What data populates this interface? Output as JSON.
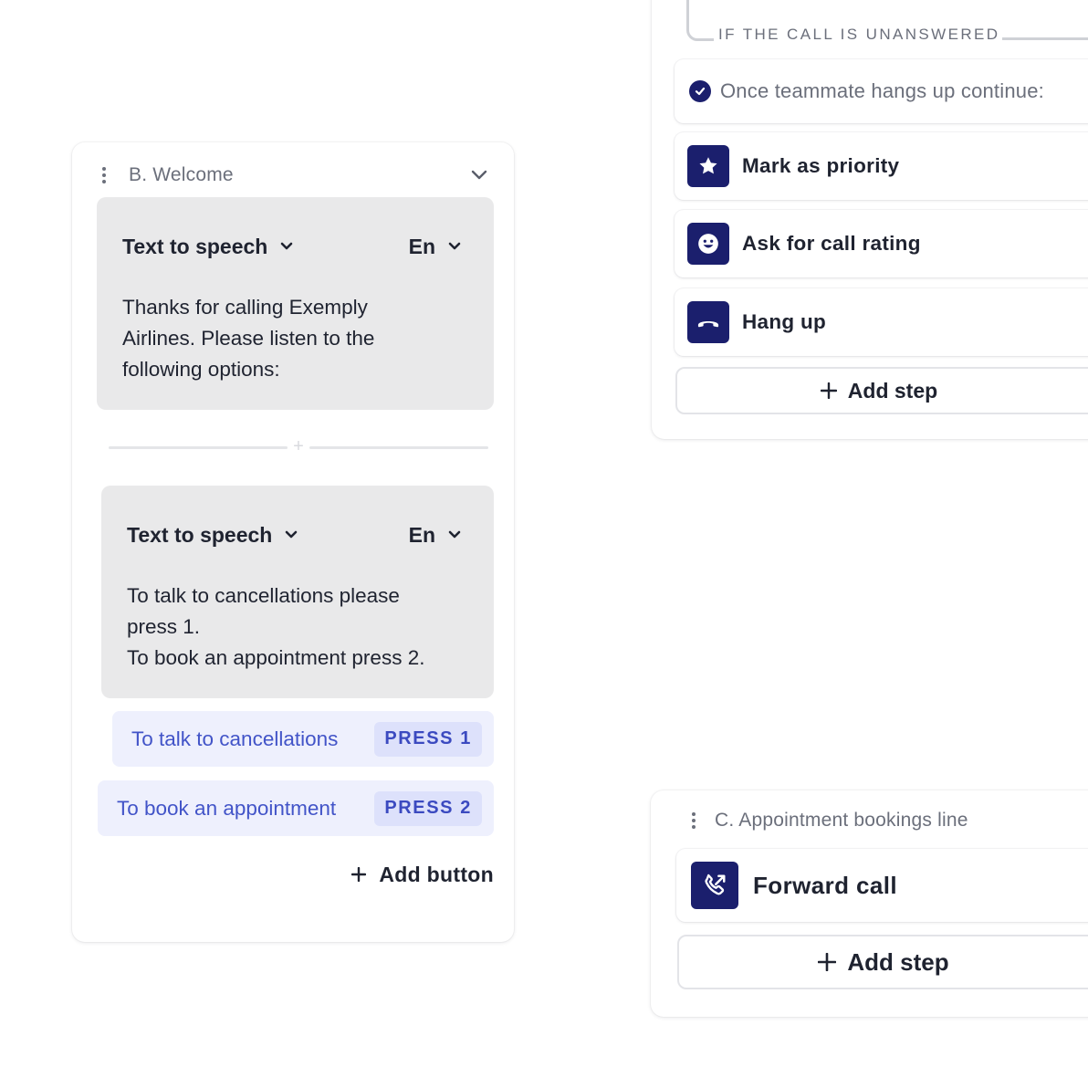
{
  "colors": {
    "icon_bg": "#1b1f6d",
    "option_bg": "#eef0fd",
    "option_text": "#4254c8",
    "badge_bg": "#dde1fb",
    "tts_block_bg": "#e9e9ea",
    "muted_text": "#6b6f7b"
  },
  "card_b": {
    "title": "B. Welcome",
    "tts_blocks": [
      {
        "type_label": "Text to speech",
        "language": "En",
        "text": "Thanks for calling Exemply\nAirlines. Please listen to the\nfollowing options:"
      },
      {
        "type_label": "Text to speech",
        "language": "En",
        "text": "To talk to cancellations please\npress 1.\nTo book an appointment press 2."
      }
    ],
    "options": [
      {
        "label": "To talk to cancellations",
        "badge": "PRESS 1"
      },
      {
        "label": "To book an appointment",
        "badge": "PRESS 2"
      }
    ],
    "add_button_label": "Add button"
  },
  "card_top": {
    "branch_label": "IF THE CALL IS UNANSWERED",
    "continue_label": "Once teammate hangs up continue:",
    "steps": [
      {
        "label": "Mark as priority",
        "icon": "star-icon"
      },
      {
        "label": "Ask for call rating",
        "icon": "smiley-icon"
      },
      {
        "label": "Hang up",
        "icon": "hang-up-icon"
      }
    ],
    "add_step_label": "Add step"
  },
  "card_c": {
    "title": "C. Appointment bookings line",
    "step": {
      "label": "Forward call",
      "icon": "forward-call-icon"
    },
    "add_step_label": "Add step"
  }
}
